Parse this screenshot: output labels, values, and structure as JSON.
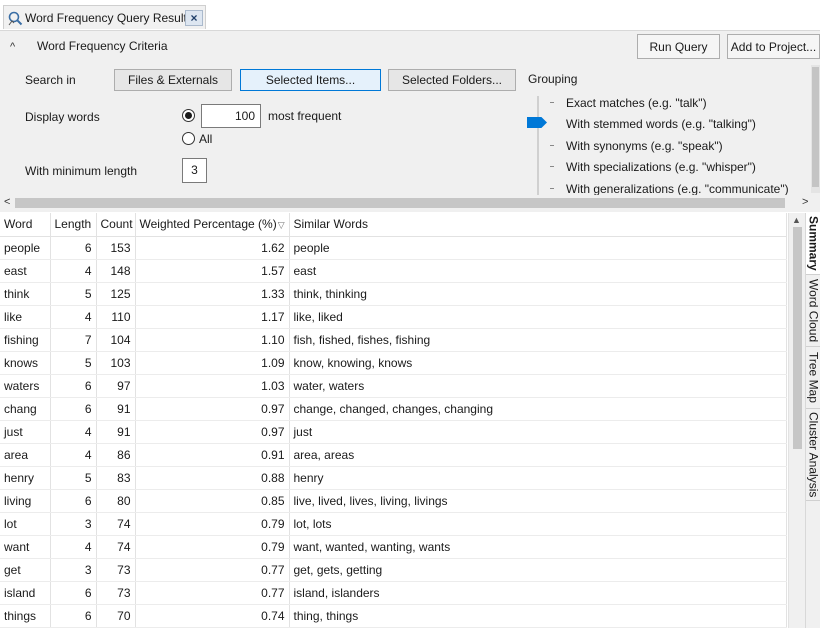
{
  "tab": {
    "title": "Word Frequency Query Results",
    "close": "×"
  },
  "criteria": {
    "title": "Word Frequency Criteria",
    "collapse_glyph": "^",
    "run_query": "Run Query",
    "add_to_project": "Add to Project...",
    "search_in_label": "Search in",
    "files_externals": "Files & Externals",
    "selected_items": "Selected Items...",
    "selected_folders": "Selected Folders...",
    "display_words_label": "Display words",
    "top_count": "100",
    "most_frequent": "most frequent",
    "all_label": "All",
    "display_mode_selected": "most frequent",
    "min_length_label": "With minimum length",
    "min_length": "3",
    "grouping_label": "Grouping",
    "grouping_options": [
      "Exact matches (e.g. \"talk\")",
      "With stemmed words (e.g. \"talking\")",
      "With synonyms (e.g. \"speak\")",
      "With specializations (e.g. \"whisper\")",
      "With generalizations (e.g. \"communicate\")"
    ],
    "grouping_selected": "With stemmed words (e.g. \"talking\")"
  },
  "scroll": {
    "left": "<",
    "right": ">"
  },
  "table": {
    "columns": [
      "Word",
      "Length",
      "Count",
      "Weighted Percentage (%)",
      "Similar Words"
    ],
    "sort_glyph": "▽",
    "rows": [
      [
        "people",
        "6",
        "153",
        "1.62",
        "people"
      ],
      [
        "east",
        "4",
        "148",
        "1.57",
        "east"
      ],
      [
        "think",
        "5",
        "125",
        "1.33",
        "think, thinking"
      ],
      [
        "like",
        "4",
        "110",
        "1.17",
        "like, liked"
      ],
      [
        "fishing",
        "7",
        "104",
        "1.10",
        "fish, fished, fishes, fishing"
      ],
      [
        "knows",
        "5",
        "103",
        "1.09",
        "know, knowing, knows"
      ],
      [
        "waters",
        "6",
        "97",
        "1.03",
        "water, waters"
      ],
      [
        "chang",
        "6",
        "91",
        "0.97",
        "change, changed, changes, changing"
      ],
      [
        "just",
        "4",
        "91",
        "0.97",
        "just"
      ],
      [
        "area",
        "4",
        "86",
        "0.91",
        "area, areas"
      ],
      [
        "henry",
        "5",
        "83",
        "0.88",
        "henry"
      ],
      [
        "living",
        "6",
        "80",
        "0.85",
        "live, lived, lives, living, livings"
      ],
      [
        "lot",
        "3",
        "74",
        "0.79",
        "lot, lots"
      ],
      [
        "want",
        "4",
        "74",
        "0.79",
        "want, wanted, wanting, wants"
      ],
      [
        "get",
        "3",
        "73",
        "0.77",
        "get, gets, getting"
      ],
      [
        "island",
        "6",
        "73",
        "0.77",
        "island, islanders"
      ],
      [
        "things",
        "6",
        "70",
        "0.74",
        "thing, things"
      ]
    ]
  },
  "side_tabs": [
    "Summary",
    "Word Cloud",
    "Tree Map",
    "Cluster Analysis"
  ],
  "side_tab_active": "Summary",
  "colors": {
    "accent": "#0078d7",
    "panel": "#f0f0f0",
    "selected_button": "#e5f1fb"
  }
}
